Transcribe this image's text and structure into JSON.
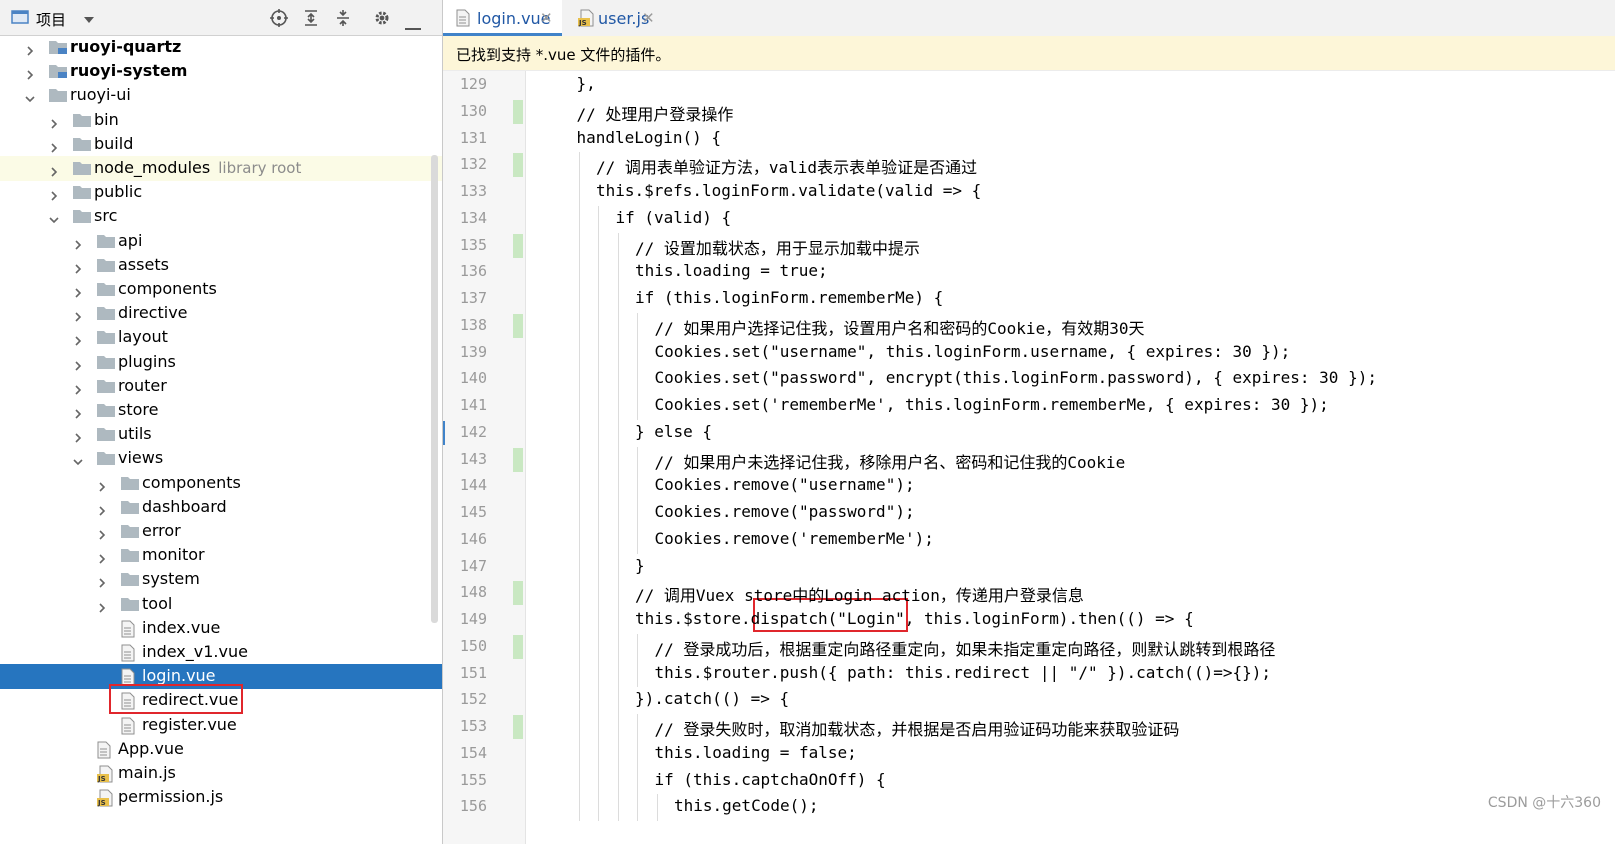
{
  "project_panel": {
    "title": "项目",
    "tree": [
      {
        "label": "ruoyi-quartz",
        "depth": 0,
        "expanded": false,
        "kind": "module",
        "bold": true
      },
      {
        "label": "ruoyi-system",
        "depth": 0,
        "expanded": false,
        "kind": "module",
        "bold": true
      },
      {
        "label": "ruoyi-ui",
        "depth": 0,
        "expanded": true,
        "kind": "folder"
      },
      {
        "label": "bin",
        "depth": 1,
        "expanded": false,
        "kind": "folder"
      },
      {
        "label": "build",
        "depth": 1,
        "expanded": false,
        "kind": "folder"
      },
      {
        "label": "node_modules",
        "depth": 1,
        "expanded": false,
        "kind": "folder",
        "suffix": "library root",
        "library": true
      },
      {
        "label": "public",
        "depth": 1,
        "expanded": false,
        "kind": "folder"
      },
      {
        "label": "src",
        "depth": 1,
        "expanded": true,
        "kind": "folder"
      },
      {
        "label": "api",
        "depth": 2,
        "expanded": false,
        "kind": "folder"
      },
      {
        "label": "assets",
        "depth": 2,
        "expanded": false,
        "kind": "folder"
      },
      {
        "label": "components",
        "depth": 2,
        "expanded": false,
        "kind": "folder"
      },
      {
        "label": "directive",
        "depth": 2,
        "expanded": false,
        "kind": "folder"
      },
      {
        "label": "layout",
        "depth": 2,
        "expanded": false,
        "kind": "folder"
      },
      {
        "label": "plugins",
        "depth": 2,
        "expanded": false,
        "kind": "folder"
      },
      {
        "label": "router",
        "depth": 2,
        "expanded": false,
        "kind": "folder"
      },
      {
        "label": "store",
        "depth": 2,
        "expanded": false,
        "kind": "folder"
      },
      {
        "label": "utils",
        "depth": 2,
        "expanded": false,
        "kind": "folder"
      },
      {
        "label": "views",
        "depth": 2,
        "expanded": true,
        "kind": "folder"
      },
      {
        "label": "components",
        "depth": 3,
        "expanded": false,
        "kind": "folder"
      },
      {
        "label": "dashboard",
        "depth": 3,
        "expanded": false,
        "kind": "folder"
      },
      {
        "label": "error",
        "depth": 3,
        "expanded": false,
        "kind": "folder"
      },
      {
        "label": "monitor",
        "depth": 3,
        "expanded": false,
        "kind": "folder"
      },
      {
        "label": "system",
        "depth": 3,
        "expanded": false,
        "kind": "folder"
      },
      {
        "label": "tool",
        "depth": 3,
        "expanded": false,
        "kind": "folder"
      },
      {
        "label": "index.vue",
        "depth": 4,
        "kind": "file"
      },
      {
        "label": "index_v1.vue",
        "depth": 4,
        "kind": "file"
      },
      {
        "label": "login.vue",
        "depth": 4,
        "kind": "file",
        "selected": true
      },
      {
        "label": "redirect.vue",
        "depth": 4,
        "kind": "file"
      },
      {
        "label": "register.vue",
        "depth": 4,
        "kind": "file"
      },
      {
        "label": "App.vue",
        "depth": 3,
        "kind": "file"
      },
      {
        "label": "main.js",
        "depth": 3,
        "kind": "js"
      },
      {
        "label": "permission.js",
        "depth": 3,
        "kind": "js"
      }
    ]
  },
  "editor": {
    "tabs": [
      {
        "label": "login.vue",
        "kind": "vue",
        "active": true
      },
      {
        "label": "user.js",
        "kind": "js",
        "active": false
      }
    ],
    "notice": "已找到支持 *.vue 文件的插件。",
    "lines": [
      {
        "n": "129",
        "indent": 1,
        "text": "},",
        "changed": false
      },
      {
        "n": "130",
        "indent": 1,
        "text": "// 处理用户登录操作",
        "changed": true
      },
      {
        "n": "131",
        "indent": 1,
        "text": "handleLogin() {",
        "changed": false
      },
      {
        "n": "132",
        "indent": 2,
        "text": "// 调用表单验证方法，valid表示表单验证是否通过",
        "changed": true
      },
      {
        "n": "133",
        "indent": 2,
        "text": "this.$refs.loginForm.validate(valid => {",
        "changed": false
      },
      {
        "n": "134",
        "indent": 3,
        "text": "if (valid) {",
        "changed": false
      },
      {
        "n": "135",
        "indent": 4,
        "text": "// 设置加载状态，用于显示加载中提示",
        "changed": true
      },
      {
        "n": "136",
        "indent": 4,
        "text": "this.loading = true;",
        "changed": false
      },
      {
        "n": "137",
        "indent": 4,
        "text": "if (this.loginForm.rememberMe) {",
        "changed": false
      },
      {
        "n": "138",
        "indent": 5,
        "text": "// 如果用户选择记住我，设置用户名和密码的Cookie，有效期30天",
        "changed": true
      },
      {
        "n": "139",
        "indent": 5,
        "text": "Cookies.set(\"username\", this.loginForm.username, { expires: 30 });",
        "changed": false
      },
      {
        "n": "140",
        "indent": 5,
        "text": "Cookies.set(\"password\", encrypt(this.loginForm.password), { expires: 30 });",
        "changed": false
      },
      {
        "n": "141",
        "indent": 5,
        "text": "Cookies.set('rememberMe', this.loginForm.rememberMe, { expires: 30 });",
        "changed": false
      },
      {
        "n": "142",
        "indent": 4,
        "text": "} else {",
        "changed": false,
        "caret": true
      },
      {
        "n": "143",
        "indent": 5,
        "text": "// 如果用户未选择记住我，移除用户名、密码和记住我的Cookie",
        "changed": true
      },
      {
        "n": "144",
        "indent": 5,
        "text": "Cookies.remove(\"username\");",
        "changed": false
      },
      {
        "n": "145",
        "indent": 5,
        "text": "Cookies.remove(\"password\");",
        "changed": false
      },
      {
        "n": "146",
        "indent": 5,
        "text": "Cookies.remove('rememberMe');",
        "changed": false
      },
      {
        "n": "147",
        "indent": 4,
        "text": "}",
        "changed": false
      },
      {
        "n": "148",
        "indent": 4,
        "text": "// 调用Vuex store中的Login action，传递用户登录信息",
        "changed": true
      },
      {
        "n": "149",
        "indent": 4,
        "text": "this.$store.dispatch(\"Login\", this.loginForm).then(() => {",
        "changed": false
      },
      {
        "n": "150",
        "indent": 5,
        "text": "// 登录成功后，根据重定向路径重定向，如果未指定重定向路径，则默认跳转到根路径",
        "changed": true
      },
      {
        "n": "151",
        "indent": 5,
        "text": "this.$router.push({ path: this.redirect || \"/\" }).catch(()=>{});",
        "changed": false
      },
      {
        "n": "152",
        "indent": 4,
        "text": "}).catch(() => {",
        "changed": false
      },
      {
        "n": "153",
        "indent": 5,
        "text": "// 登录失败时，取消加载状态，并根据是否启用验证码功能来获取验证码",
        "changed": true
      },
      {
        "n": "154",
        "indent": 5,
        "text": "this.loading = false;",
        "changed": false
      },
      {
        "n": "155",
        "indent": 5,
        "text": "if (this.captchaOnOff) {",
        "changed": false
      },
      {
        "n": "156",
        "indent": 6,
        "text": "this.getCode();",
        "changed": false
      }
    ]
  },
  "watermark": "CSDN @十六360",
  "colors": {
    "selection": "#2675bf",
    "highlight_box": "#e0262c",
    "tab_underline": "#4083c9",
    "notice_bg": "#fdf6d8",
    "changed_marker": "#c9e8c2"
  }
}
